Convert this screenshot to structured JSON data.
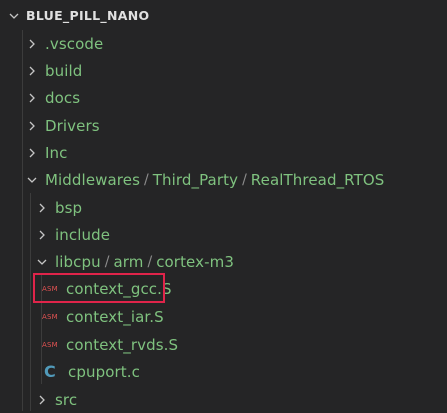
{
  "explorer": {
    "root": "BLUE_PILL_NANO",
    "items": {
      "vscode": ".vscode",
      "build": "build",
      "docs": "docs",
      "drivers": "Drivers",
      "inc": "Inc",
      "middlewares": "Middlewares",
      "third_party": "Third_Party",
      "realthread": "RealThread_RTOS",
      "bsp": "bsp",
      "include": "include",
      "libcpu": "libcpu",
      "arm": "arm",
      "cortex": "cortex-m3",
      "context_gcc": "context_gcc.S",
      "context_iar": "context_iar.S",
      "context_rvds": "context_rvds.S",
      "cpuport": "cpuport.c",
      "src": "src"
    },
    "path_separator": "/",
    "asm_badge": "ASM",
    "c_badge": "C"
  },
  "colors": {
    "background": "#252526",
    "folder_text": "#7fc27f",
    "asm_icon": "#e05252",
    "c_icon": "#519aba",
    "highlight": "#e0244a"
  }
}
